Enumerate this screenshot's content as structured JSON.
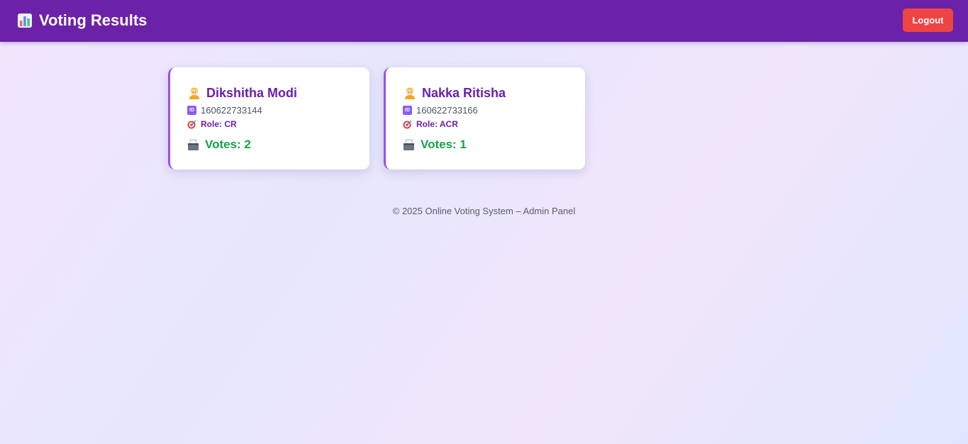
{
  "header": {
    "title": "Voting Results",
    "title_icon": "bar-chart-icon",
    "logout_label": "Logout",
    "logout_color": "#ef4444",
    "background_color": "#6b21a8"
  },
  "candidates": [
    {
      "name": "Dikshitha Modi",
      "id": "160622733144",
      "role": "Role: CR",
      "votes": "Votes: 2"
    },
    {
      "name": "Nakka Ritisha",
      "id": "160622733166",
      "role": "Role: ACR",
      "votes": "Votes: 1"
    }
  ],
  "footer": {
    "text": "© 2025 Online Voting System – Admin Panel"
  },
  "colors": {
    "name": "#6b21a8",
    "votes": "#16a34a",
    "card_accent": "#9b51e0"
  }
}
